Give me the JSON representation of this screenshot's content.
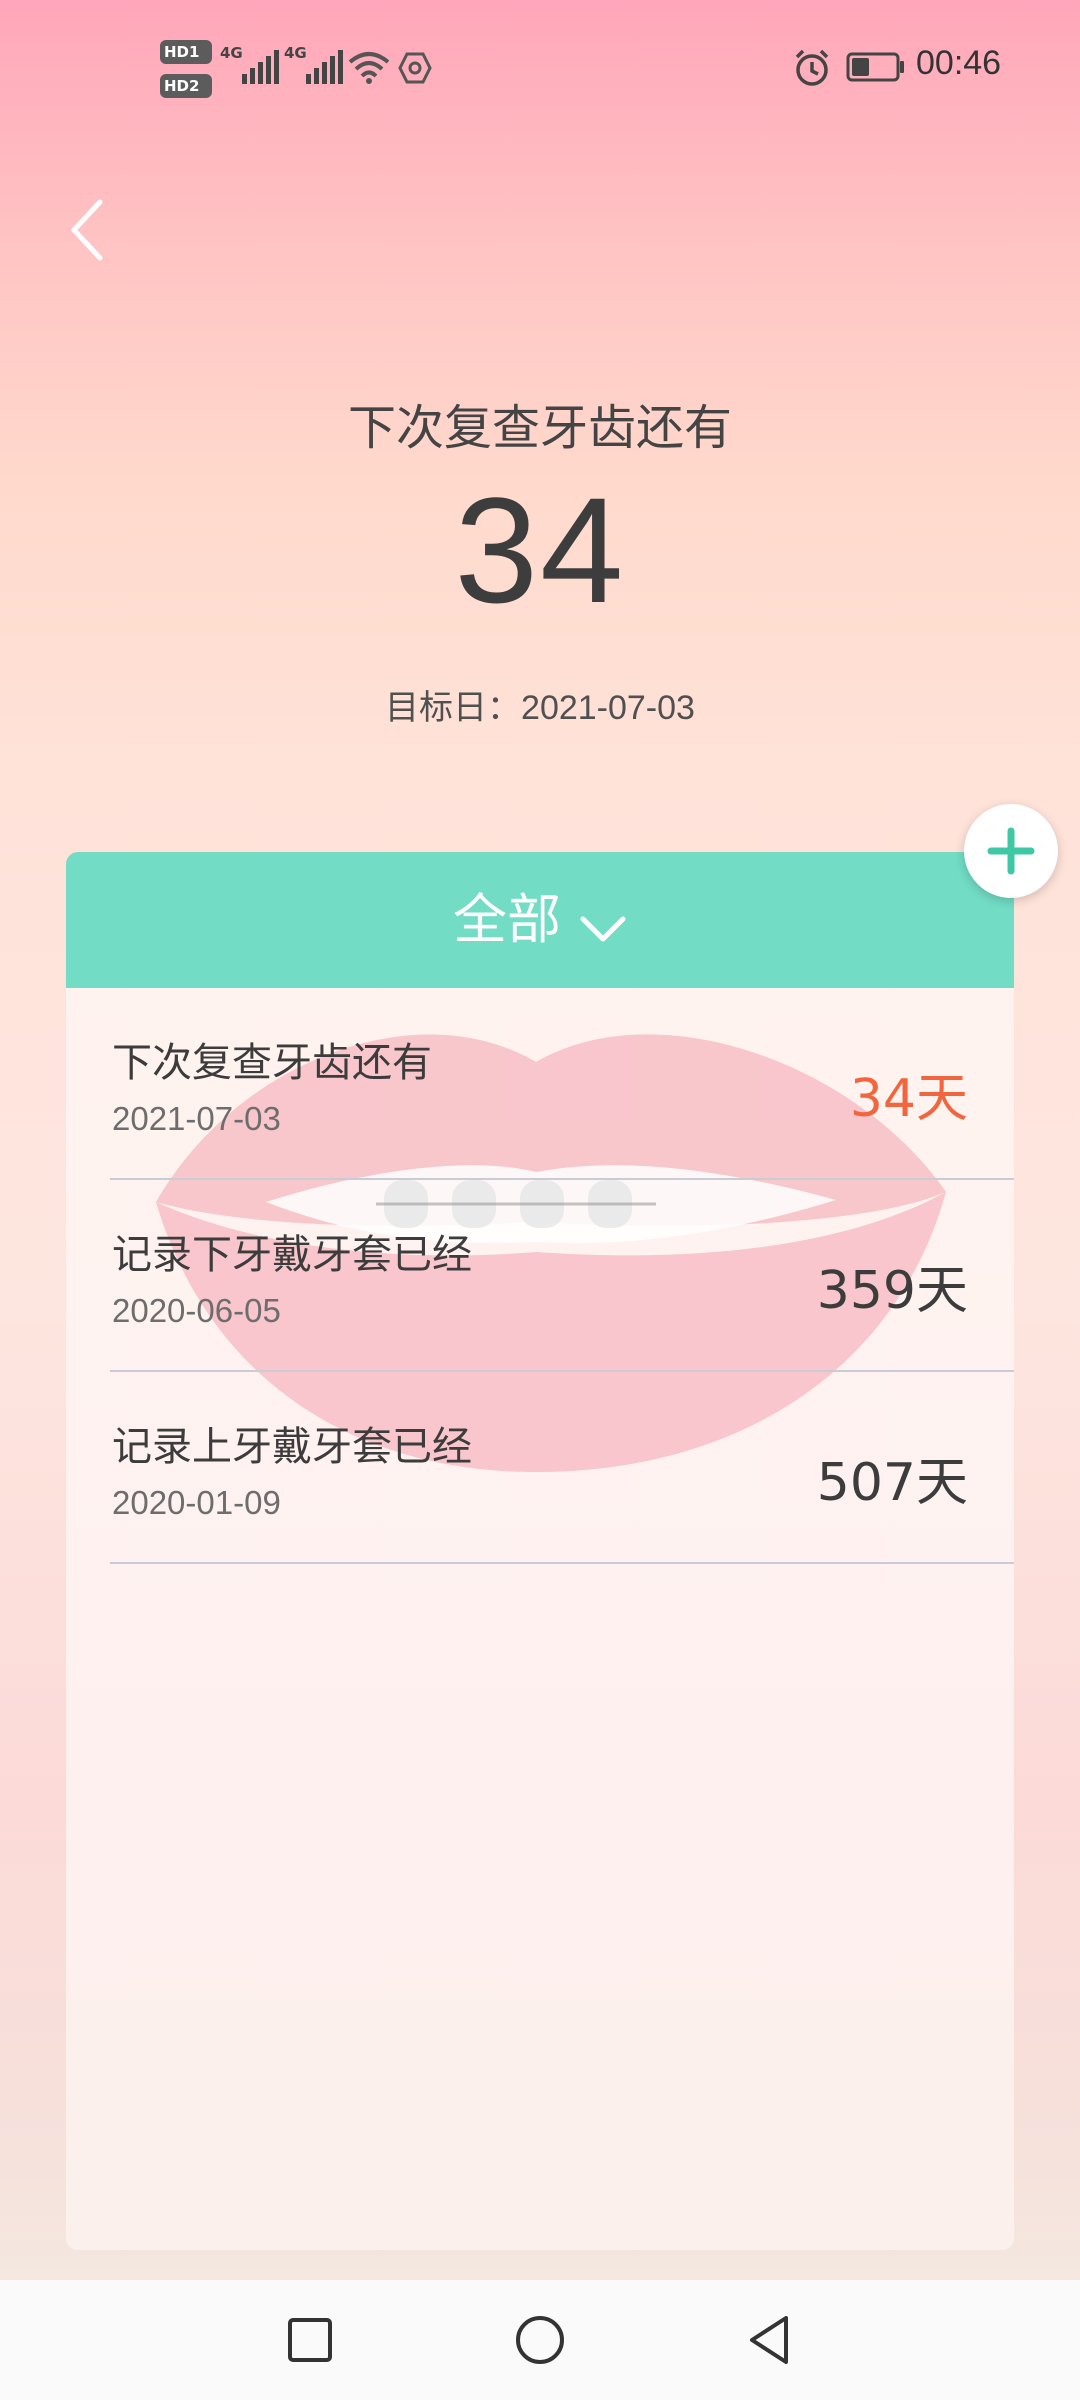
{
  "status_bar": {
    "sim1": "HD1",
    "sim2": "HD2",
    "network1": "4G",
    "network2": "4G",
    "time": "00:46",
    "battery_level": 0.4
  },
  "header": {
    "headline": "下次复查牙齿还有",
    "countdown": "34",
    "target_label": "目标日：",
    "target_date": "2021-07-03"
  },
  "card": {
    "filter_label": "全部",
    "items": [
      {
        "title": "下次复查牙齿还有",
        "date": "2021-07-03",
        "days": "34天",
        "highlight": true
      },
      {
        "title": "记录下牙戴牙套已经",
        "date": "2020-06-05",
        "days": "359天",
        "highlight": false
      },
      {
        "title": "记录上牙戴牙套已经",
        "date": "2020-01-09",
        "days": "507天",
        "highlight": false
      }
    ]
  },
  "colors": {
    "accent": "#72dcc5",
    "highlight": "#f2663f",
    "background_top": "#ffa6ba"
  },
  "icons": {
    "back": "chevron-left-icon",
    "add": "plus-icon",
    "filter": "chevron-down-icon"
  }
}
